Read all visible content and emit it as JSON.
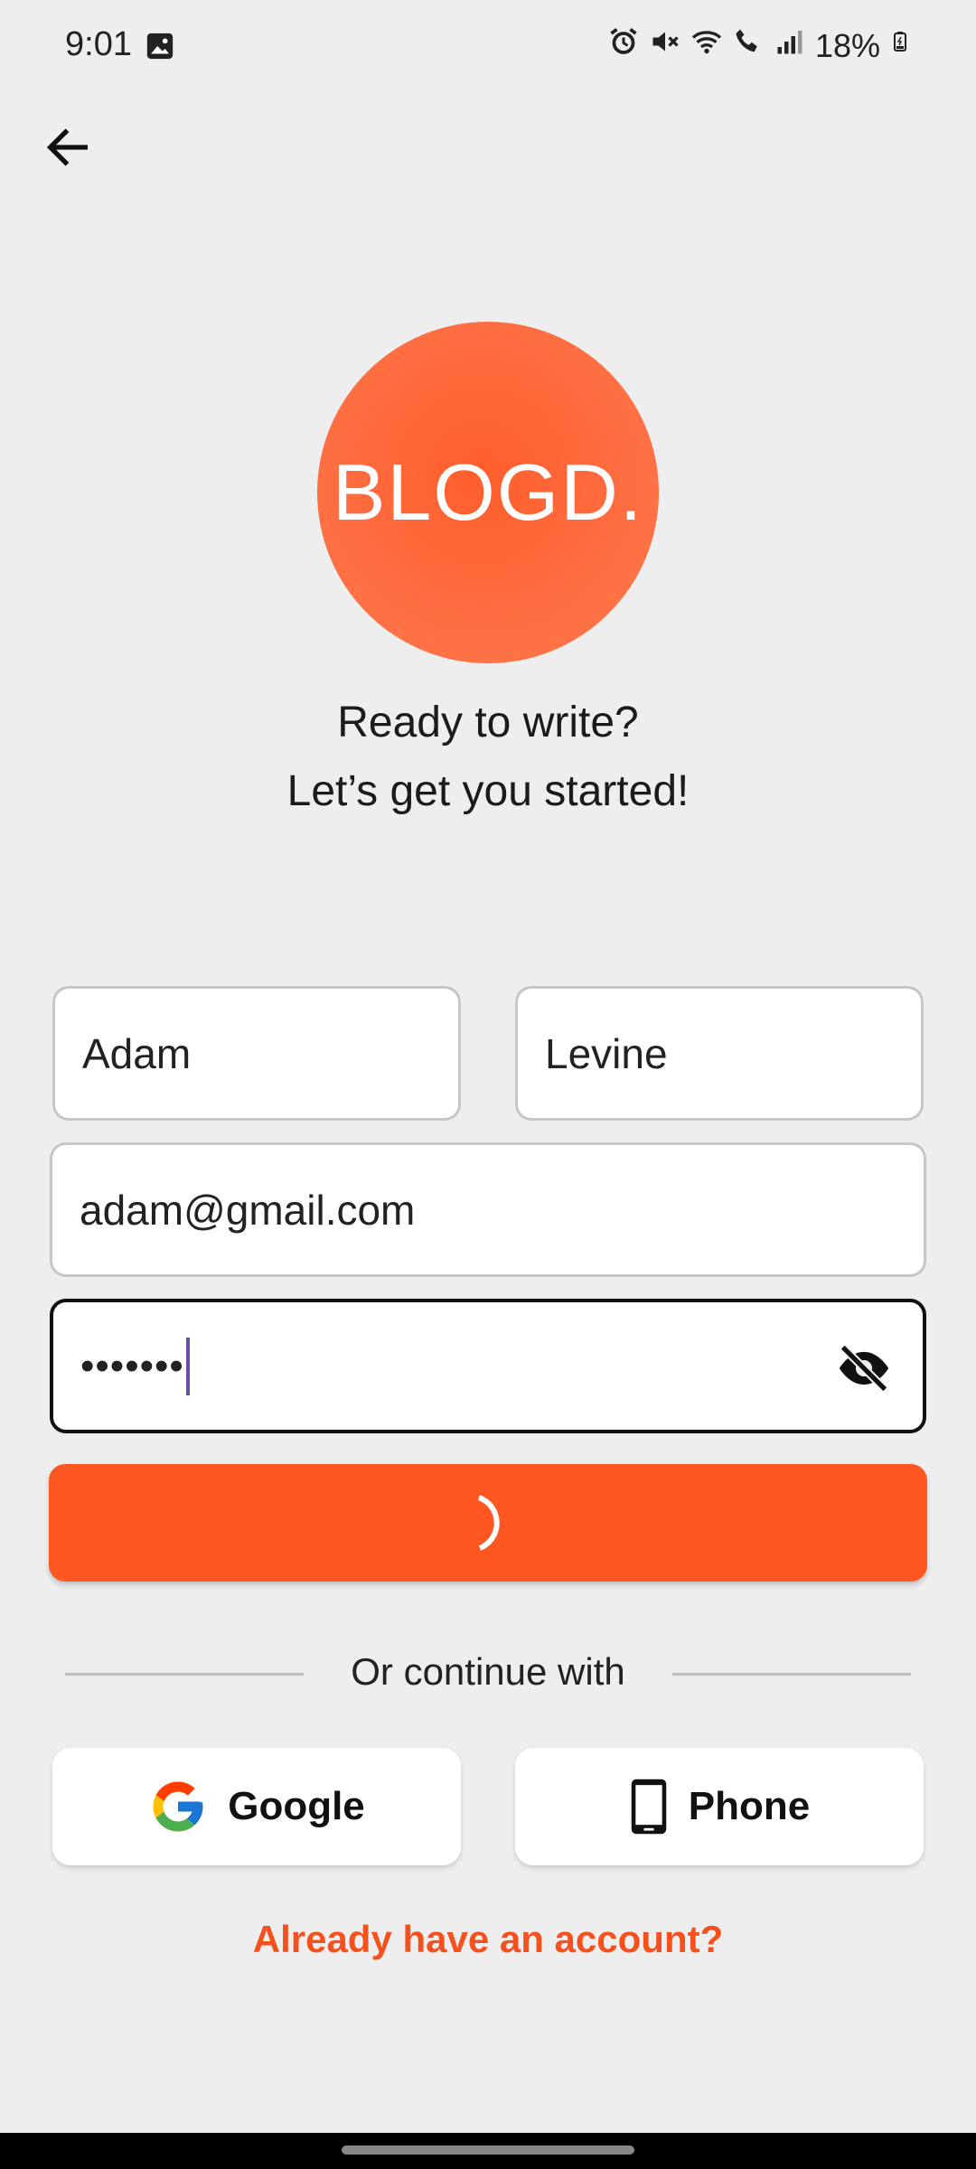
{
  "status_bar": {
    "time": "9:01",
    "battery": "18%",
    "icons": [
      "image-icon",
      "alarm-icon",
      "mute-icon",
      "wifi-icon",
      "wifi-call-icon",
      "signal-icon",
      "battery-icon"
    ]
  },
  "logo": {
    "text": "BLOGD.",
    "color": "#ff6a3d"
  },
  "tagline": {
    "line1": "Ready to write?",
    "line2": "Let’s get you started!"
  },
  "form": {
    "first_name": "Adam",
    "last_name": "Levine",
    "email": "adam@gmail.com",
    "password_masked": "•••••••",
    "submit_state": "loading",
    "accent": "#ff5722"
  },
  "divider_text": "Or continue with",
  "social": {
    "google_label": "Google",
    "phone_label": "Phone"
  },
  "signin_link": "Already have an account?"
}
